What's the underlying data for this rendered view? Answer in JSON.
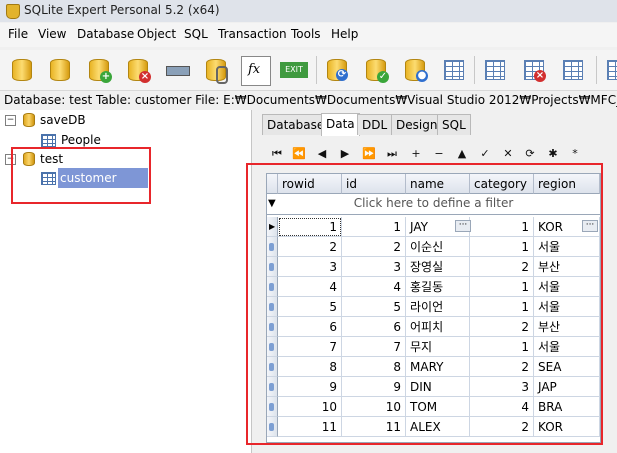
{
  "window": {
    "title": "SQLite Expert Personal 5.2 (x64)"
  },
  "menu": [
    "File",
    "View",
    "Database",
    "Object",
    "SQL",
    "Transaction",
    "Tools",
    "Help"
  ],
  "toolbar": {
    "icons": [
      "new-database-icon",
      "open-database-icon",
      "attach-database-icon",
      "detach-database-icon",
      "vacuum-icon",
      "backup-icon",
      "function-icon",
      "exit-icon",
      "refresh-icon",
      "check-icon",
      "user-icon",
      "table-grid-icon",
      "new-table-icon",
      "edit-table-icon",
      "new-view-icon"
    ],
    "exit_label": "EXIT",
    "fx_label": "fx"
  },
  "pathbar": {
    "text": "Database: test   Table: customer   File: E:₩Documents₩Documents₩Visual Studio 2012₩Projects₩MFC_Listbox_te"
  },
  "tree": {
    "databases": [
      {
        "name": "saveDB",
        "expanded": true,
        "tables": [
          "People"
        ]
      },
      {
        "name": "test",
        "expanded": true,
        "tables": [
          "customer"
        ]
      }
    ],
    "selected": "customer"
  },
  "tabs": [
    "Database",
    "Data",
    "DDL",
    "Design",
    "SQL"
  ],
  "active_tab": "Data",
  "navigator": [
    "⏮",
    "⏪",
    "◀",
    "▶",
    "⏩",
    "⏭",
    "+",
    "−",
    "▲",
    "✓",
    "✕",
    "⟳",
    "✱",
    "*"
  ],
  "grid": {
    "columns": [
      "rowid",
      "id",
      "name",
      "category",
      "region"
    ],
    "filter_text": "Click here to define a filter",
    "rows": [
      [
        "1",
        "1",
        "JAY",
        "1",
        "KOR"
      ],
      [
        "2",
        "2",
        "이순신",
        "1",
        "서울"
      ],
      [
        "3",
        "3",
        "장영실",
        "2",
        "부산"
      ],
      [
        "4",
        "4",
        "홍길동",
        "1",
        "서울"
      ],
      [
        "5",
        "5",
        "라이언",
        "1",
        "서울"
      ],
      [
        "6",
        "6",
        "어피치",
        "2",
        "부산"
      ],
      [
        "7",
        "7",
        "무지",
        "1",
        "서울"
      ],
      [
        "8",
        "8",
        "MARY",
        "2",
        "SEA"
      ],
      [
        "9",
        "9",
        "DIN",
        "3",
        "JAP"
      ],
      [
        "10",
        "10",
        "TOM",
        "4",
        "BRA"
      ],
      [
        "11",
        "11",
        "ALEX",
        "2",
        "KOR"
      ]
    ]
  },
  "colors": {
    "highlight": "#e8262b",
    "selection": "#7e96d6"
  }
}
